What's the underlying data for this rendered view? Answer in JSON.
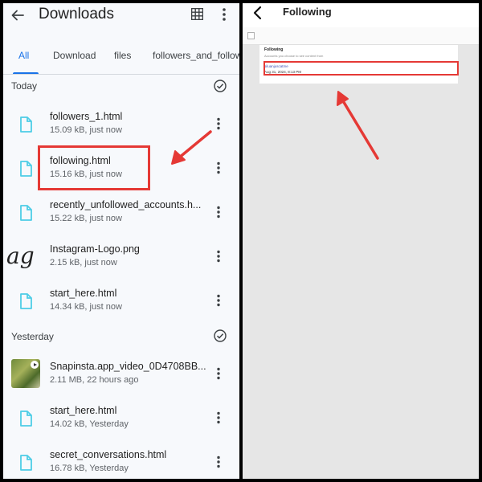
{
  "left": {
    "title": "Downloads",
    "tabs": [
      "All",
      "Download",
      "files",
      "followers_and_followi"
    ],
    "sections": {
      "today": "Today",
      "yesterday": "Yesterday"
    },
    "files": [
      {
        "name": "followers_1.html",
        "meta": "15.09 kB, just now"
      },
      {
        "name": "following.html",
        "meta": "15.16 kB, just now"
      },
      {
        "name": "recently_unfollowed_accounts.h...",
        "meta": "15.22 kB, just now"
      },
      {
        "name": "Instagram-Logo.png",
        "meta": "2.15 kB, just now",
        "thumb_text": "ag"
      },
      {
        "name": "start_here.html",
        "meta": "14.34 kB, just now"
      },
      {
        "name": "Snapinsta.app_video_0D4708BB...",
        "meta": "2.11 MB, 22 hours ago"
      },
      {
        "name": "start_here.html",
        "meta": "14.02 kB, Yesterday"
      },
      {
        "name": "secret_conversations.html",
        "meta": "16.78 kB, Yesterday"
      }
    ]
  },
  "right": {
    "title": "Following",
    "card_heading": "Following",
    "card_sub": "Accounts you choose to see content from",
    "username": "siluanjuscatme",
    "date": "Aug 31, 2024, 8:13 PM"
  },
  "colors": {
    "accent": "#1a73e8",
    "highlight": "#e53935",
    "file_icon": "#4ecde6"
  }
}
